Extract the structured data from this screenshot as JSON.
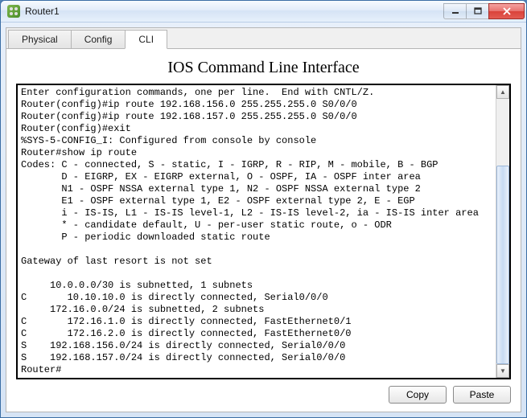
{
  "window": {
    "title": "Router1"
  },
  "tabs": [
    {
      "label": "Physical",
      "active": false
    },
    {
      "label": "Config",
      "active": false
    },
    {
      "label": "CLI",
      "active": true
    }
  ],
  "heading": "IOS Command Line Interface",
  "terminal_lines": [
    "Enter configuration commands, one per line.  End with CNTL/Z.",
    "Router(config)#ip route 192.168.156.0 255.255.255.0 S0/0/0",
    "Router(config)#ip route 192.168.157.0 255.255.255.0 S0/0/0",
    "Router(config)#exit",
    "%SYS-5-CONFIG_I: Configured from console by console",
    "Router#show ip route",
    "Codes: C - connected, S - static, I - IGRP, R - RIP, M - mobile, B - BGP",
    "       D - EIGRP, EX - EIGRP external, O - OSPF, IA - OSPF inter area",
    "       N1 - OSPF NSSA external type 1, N2 - OSPF NSSA external type 2",
    "       E1 - OSPF external type 1, E2 - OSPF external type 2, E - EGP",
    "       i - IS-IS, L1 - IS-IS level-1, L2 - IS-IS level-2, ia - IS-IS inter area",
    "       * - candidate default, U - per-user static route, o - ODR",
    "       P - periodic downloaded static route",
    "",
    "Gateway of last resort is not set",
    "",
    "     10.0.0.0/30 is subnetted, 1 subnets",
    "C       10.10.10.0 is directly connected, Serial0/0/0",
    "     172.16.0.0/24 is subnetted, 2 subnets",
    "C       172.16.1.0 is directly connected, FastEthernet0/1",
    "C       172.16.2.0 is directly connected, FastEthernet0/0",
    "S    192.168.156.0/24 is directly connected, Serial0/0/0",
    "S    192.168.157.0/24 is directly connected, Serial0/0/0",
    "Router#"
  ],
  "buttons": {
    "copy": "Copy",
    "paste": "Paste"
  }
}
